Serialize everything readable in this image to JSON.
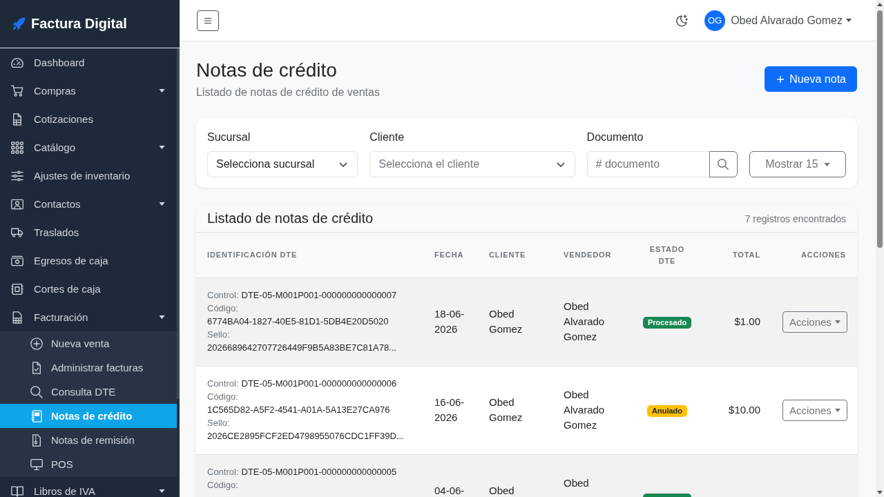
{
  "sidebar": {
    "brand": "Factura Digital",
    "items": [
      {
        "label": "Dashboard",
        "expandable": false,
        "selected": false
      },
      {
        "label": "Compras",
        "expandable": true,
        "selected": false
      },
      {
        "label": "Cotizaciones",
        "expandable": false,
        "selected": false
      },
      {
        "label": "Catálogo",
        "expandable": true,
        "selected": false
      },
      {
        "label": "Ajustes de inventario",
        "expandable": false,
        "selected": false
      },
      {
        "label": "Contactos",
        "expandable": true,
        "selected": false
      },
      {
        "label": "Traslados",
        "expandable": false,
        "selected": false
      },
      {
        "label": "Egresos de caja",
        "expandable": false,
        "selected": false
      },
      {
        "label": "Cortes de caja",
        "expandable": false,
        "selected": false
      },
      {
        "label": "Facturación",
        "expandable": true,
        "selected": false,
        "children": [
          {
            "label": "Nueva venta",
            "selected": false
          },
          {
            "label": "Administrar facturas",
            "selected": false
          },
          {
            "label": "Consulta DTE",
            "selected": false
          },
          {
            "label": "Notas de crédito",
            "selected": true
          },
          {
            "label": "Notas de remisión",
            "selected": false
          },
          {
            "label": "POS",
            "selected": false
          }
        ]
      },
      {
        "label": "Libros de IVA",
        "expandable": true,
        "selected": false
      }
    ]
  },
  "topbar": {
    "user": {
      "initials": "OG",
      "name": "Obed Alvarado Gomez"
    }
  },
  "page": {
    "title": "Notas de crédito",
    "subtitle": "Listado de notas de crédito de ventas",
    "new_button": "Nueva nota"
  },
  "filters": {
    "fields": [
      {
        "kind": "select",
        "label": "Sucursal",
        "value": "Selecciona sucursal"
      },
      {
        "kind": "select",
        "label": "Cliente",
        "placeholder": "Selecciona el cliente"
      },
      {
        "kind": "search",
        "label": "Documento",
        "placeholder": "# documento"
      }
    ],
    "page_size_button": "Mostrar 15"
  },
  "list": {
    "title": "Listado de notas de crédito",
    "count": "7 registros encontrados",
    "columns": [
      "IDENTIFICACIÓN DTE",
      "FECHA",
      "CLIENTE",
      "VENDEDOR",
      "ESTADO DTE",
      "TOTAL",
      "ACCIONES"
    ],
    "rows": [
      {
        "control_label": "Control:",
        "control": "DTE-05-M001P001-000000000000007",
        "code_label": "Código:",
        "code": "6774BA04-1827-40E5-81D1-5DB4E20D5020",
        "seal_label": "Sello:",
        "seal": "2026689642707726449F9B5A83BE7C81A78...",
        "date": "18-06-2026",
        "client": "Obed Gomez",
        "seller": "Obed Alvarado Gomez",
        "status": {
          "kind": "processed",
          "label": "Procesado"
        },
        "total": "$1.00",
        "action": "Acciones"
      },
      {
        "control_label": "Control:",
        "control": "DTE-05-M001P001-000000000000006",
        "code_label": "Código:",
        "code": "1C565D82-A5F2-4541-A01A-5A13E27CA976",
        "seal_label": "Sello:",
        "seal": "2026CE2895FCF2ED4798955076CDC1FF39D...",
        "date": "16-06-2026",
        "client": "Obed Gomez",
        "seller": "Obed Alvarado Gomez",
        "status": {
          "kind": "voided",
          "label": "Anulado"
        },
        "total": "$10.00",
        "action": "Acciones"
      },
      {
        "control_label": "Control:",
        "control": "DTE-05-M001P001-000000000000005",
        "code_label": "Código:",
        "date": "04-06-",
        "client": "Obed",
        "seller": "Obed",
        "status": {
          "kind": "processed"
        }
      }
    ]
  }
}
